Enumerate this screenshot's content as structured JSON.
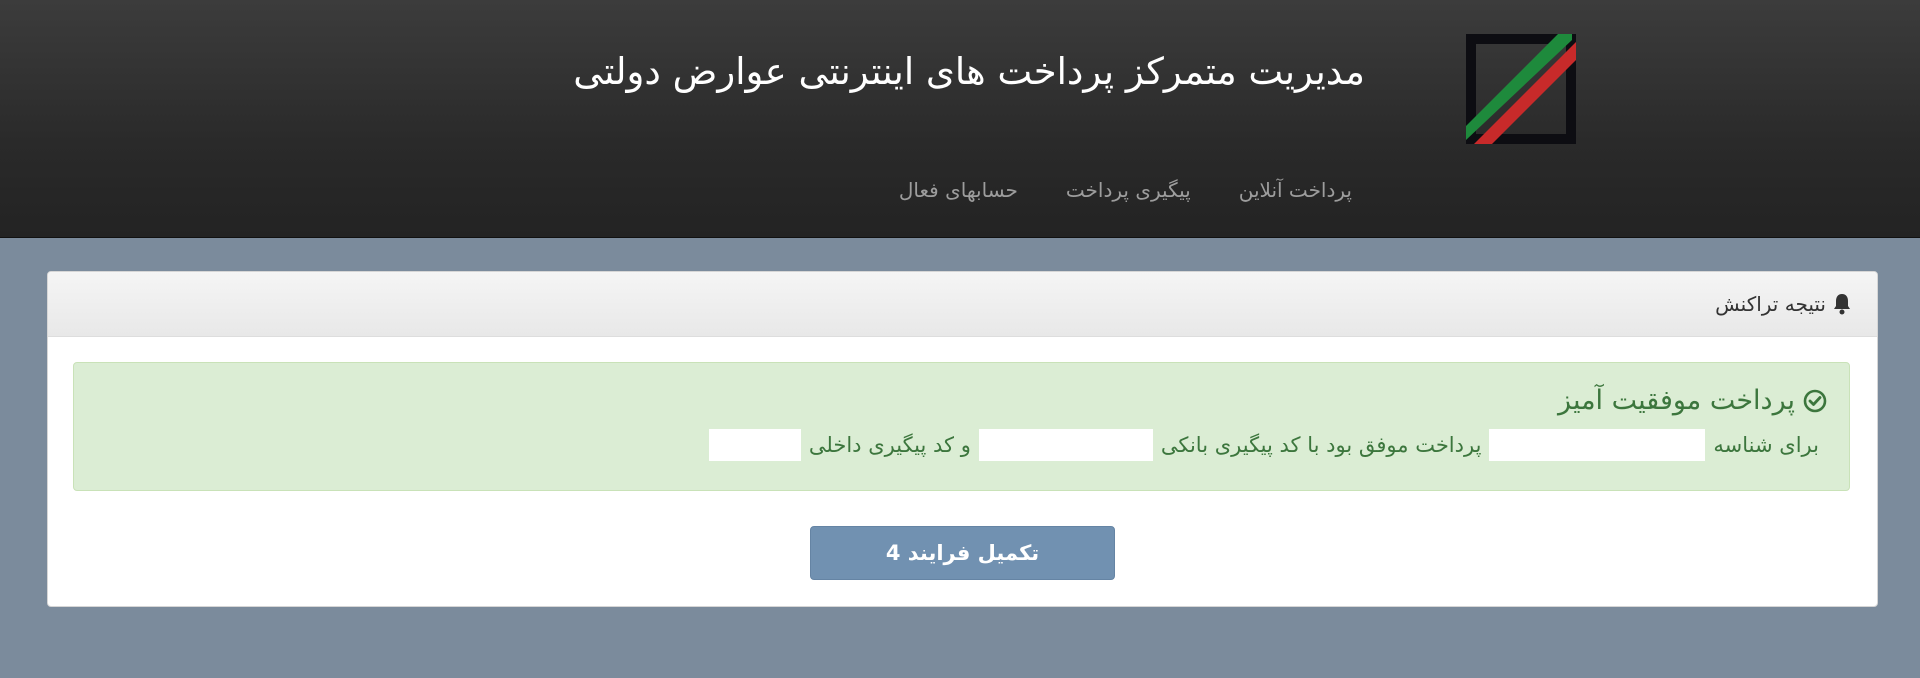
{
  "header": {
    "title": "مدیریت متمرکز پرداخت های اینترنتی عوارض دولتی",
    "logo_icon": "stripe-logo-icon",
    "nav": [
      {
        "label": "پرداخت آنلاین"
      },
      {
        "label": "پیگیری پرداخت"
      },
      {
        "label": "حسابهای فعال"
      }
    ]
  },
  "panel": {
    "title": "نتیجه تراکنش",
    "title_icon": "bell-icon",
    "alert": {
      "icon": "check-circle-icon",
      "title": "پرداخت موفقیت آمیز",
      "text_part1": "برای شناسه",
      "text_part2": "پرداخت موفق بود با کد پیگیری بانکی",
      "text_part3": "و کد پیگیری داخلی"
    },
    "button_label": "تکمیل فرایند 4"
  },
  "colors": {
    "header_bg": "#2a2a2a",
    "page_bg": "#7b8b9c",
    "alert_bg": "#dbedd4",
    "alert_text": "#3c763d",
    "button_bg": "#7191b1",
    "logo_green": "#1e8a3c",
    "logo_red": "#c82a2a"
  }
}
